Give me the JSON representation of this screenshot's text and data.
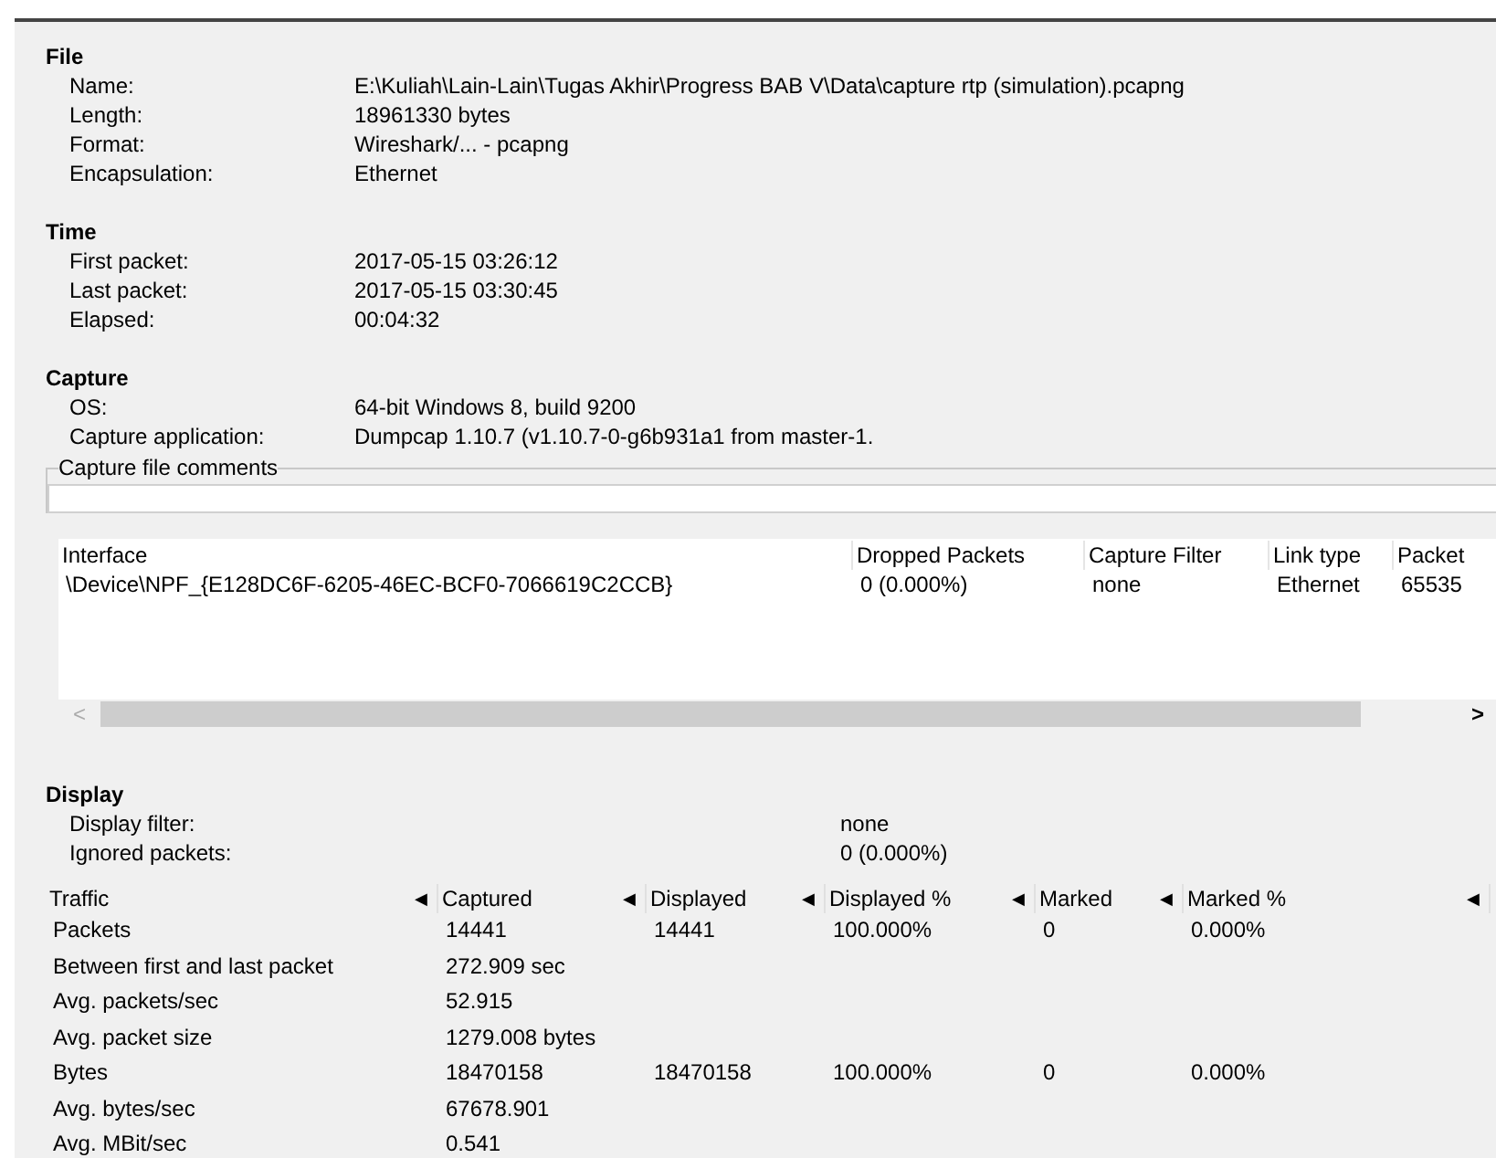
{
  "sections": [
    {
      "title": "File",
      "rows": [
        {
          "label": "Name:",
          "value": "E:\\Kuliah\\Lain-Lain\\Tugas Akhir\\Progress BAB V\\Data\\capture rtp (simulation).pcapng"
        },
        {
          "label": "Length:",
          "value": "18961330 bytes"
        },
        {
          "label": "Format:",
          "value": "Wireshark/... - pcapng"
        },
        {
          "label": "Encapsulation:",
          "value": "Ethernet"
        }
      ]
    },
    {
      "title": "Time",
      "rows": [
        {
          "label": "First packet:",
          "value": "2017-05-15 03:26:12"
        },
        {
          "label": "Last packet:",
          "value": "2017-05-15 03:30:45"
        },
        {
          "label": "Elapsed:",
          "value": "00:04:32"
        }
      ]
    },
    {
      "title": "Capture",
      "rows": [
        {
          "label": "OS:",
          "value": "64-bit Windows 8, build 9200"
        },
        {
          "label": "Capture application:",
          "value": "Dumpcap 1.10.7 (v1.10.7-0-g6b931a1 from master-1."
        }
      ]
    }
  ],
  "comments": {
    "title": "Capture file comments"
  },
  "interfaces": {
    "columns": [
      "Interface",
      "Dropped Packets",
      "Capture Filter",
      "Link type",
      "Packet"
    ],
    "rows": [
      [
        "\\Device\\NPF_{E128DC6F-6205-46EC-BCF0-7066619C2CCB}",
        "0 (0.000%)",
        "none",
        "Ethernet",
        "65535"
      ]
    ],
    "scroll_left": "<",
    "scroll_right": ">"
  },
  "display": {
    "title": "Display",
    "rows": [
      {
        "label": "Display filter:",
        "value": "none"
      },
      {
        "label": "Ignored packets:",
        "value": "0 (0.000%)"
      }
    ]
  },
  "traffic": {
    "columns": [
      {
        "label": "Traffic",
        "arrow": "◀"
      },
      {
        "label": "Captured",
        "arrow": "◀"
      },
      {
        "label": "Displayed",
        "arrow": "◀"
      },
      {
        "label": "Displayed %",
        "arrow": "◀"
      },
      {
        "label": "Marked",
        "arrow": "◀"
      },
      {
        "label": "Marked %",
        "arrow": "◀"
      }
    ],
    "rows": [
      [
        "Packets",
        "14441",
        "14441",
        "100.000%",
        "0",
        "0.000%"
      ],
      [
        "Between first and last packet",
        "272.909 sec"
      ],
      [
        "Avg. packets/sec",
        "52.915"
      ],
      [
        "Avg. packet size",
        "1279.008 bytes"
      ],
      [
        "Bytes",
        "18470158",
        "18470158",
        "100.000%",
        "0",
        "0.000%"
      ],
      [
        "Avg. bytes/sec",
        "67678.901"
      ],
      [
        "Avg. MBit/sec",
        "0.541"
      ]
    ]
  }
}
